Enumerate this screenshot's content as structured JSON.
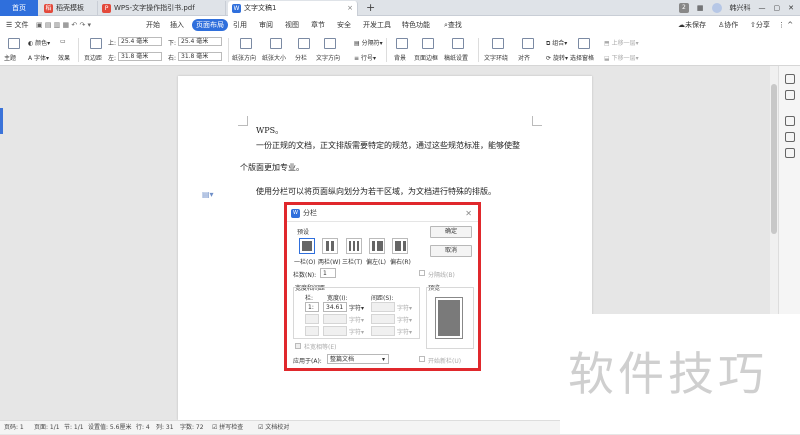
{
  "tabs": {
    "home": "首页",
    "tab1": "稻壳模板",
    "tab2": "WPS-文字操作指引书.pdf",
    "tab3": "文字文稿1",
    "new_tab": "+"
  },
  "window": {
    "badge": "2",
    "user": "韩兴科"
  },
  "menu": {
    "file": "文件",
    "items": [
      "开始",
      "插入",
      "页面布局",
      "引用",
      "审阅",
      "视图",
      "章节",
      "安全",
      "开发工具",
      "特色功能",
      "查找"
    ],
    "unsaved": "未保存",
    "collab": "协作",
    "share": "分享"
  },
  "ribbon": {
    "theme": "主题",
    "color": "颜色",
    "font": "字体",
    "effect": "效果",
    "margins": "页边距",
    "top_label": "上:",
    "top_value": "25.4 毫米",
    "bottom_label": "下:",
    "bottom_value": "25.4 毫米",
    "left_label": "左:",
    "left_value": "31.8 毫米",
    "right_label": "右:",
    "right_value": "31.8 毫米",
    "orientation": "纸张方向",
    "size": "纸张大小",
    "columns": "分栏",
    "text_dir": "文字方向",
    "line_no": "行号",
    "breaks": "分隔符",
    "background": "背景",
    "border": "页面边框",
    "grid": "稿纸设置",
    "wrap": "文字环绕",
    "align": "对齐",
    "rotate": "旋转",
    "group": "组合",
    "select_pane": "选择窗格",
    "up": "上移一层",
    "down": "下移一层"
  },
  "document": {
    "line1": "WPS。",
    "line2": "一份正规的文档，正文排版需要特定的规范，通过这些规范标准，能够使整",
    "line3": "个版面更加专业。",
    "line4": "使用分栏可以将页面纵向划分为若干区域，为文档进行特殊的排版。"
  },
  "dialog": {
    "title": "分栏",
    "presets_label": "预设",
    "presets": [
      "一栏(O)",
      "两栏(W)",
      "三栏(T)",
      "偏左(L)",
      "偏右(R)"
    ],
    "ok": "确定",
    "cancel": "取消",
    "num_cols_label": "栏数(N):",
    "num_cols_value": "1",
    "line_between": "分隔线(B)",
    "width_spacing": "宽度和间距",
    "col_header": "栏:",
    "width_header": "宽度(I):",
    "spacing_header": "间距(S):",
    "row1_col": "1:",
    "row1_width": "34.61",
    "unit": "字符▾",
    "equal_width": "栏宽相等(E)",
    "preview": "预览",
    "apply_label": "应用于(A):",
    "apply_value": "整篇文档",
    "new_col": "开始新栏(U)"
  },
  "status": {
    "page_no": "页码: 1",
    "page": "页面: 1/1",
    "section": "节: 1/1",
    "setting": "设置值: 5.6厘米",
    "row": "行: 4",
    "col": "列: 31",
    "words": "字数: 72",
    "spell": "拼写检查",
    "proof": "文档校对"
  },
  "watermark": "软件技巧",
  "colors": {
    "accent": "#2f6fdc",
    "highlight": "#e0282c"
  }
}
